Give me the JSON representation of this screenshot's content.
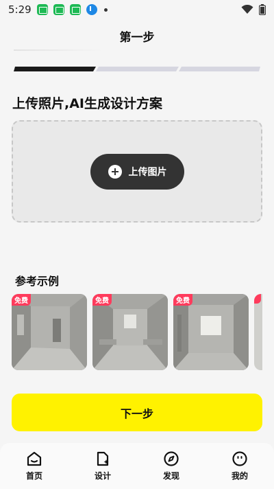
{
  "status": {
    "time": "5:29"
  },
  "header": {
    "title": "第一步"
  },
  "progress": {
    "steps_total": 3,
    "current_step": 1
  },
  "upload": {
    "heading": "上传照片,AI生成设计方案",
    "button_label": "上传图片"
  },
  "examples": {
    "heading": "参考示例",
    "items": [
      {
        "badge": "免费"
      },
      {
        "badge": "免费"
      },
      {
        "badge": "免费"
      }
    ]
  },
  "actions": {
    "next_label": "下一步"
  },
  "bottom_nav": {
    "items": [
      {
        "label": "首页",
        "icon": "home-icon"
      },
      {
        "label": "设计",
        "icon": "design-icon"
      },
      {
        "label": "发现",
        "icon": "compass-icon"
      },
      {
        "label": "我的",
        "icon": "smile-icon"
      }
    ]
  },
  "colors": {
    "accent": "#fff200",
    "badge": "#ff3b5c",
    "dark": "#333333"
  }
}
